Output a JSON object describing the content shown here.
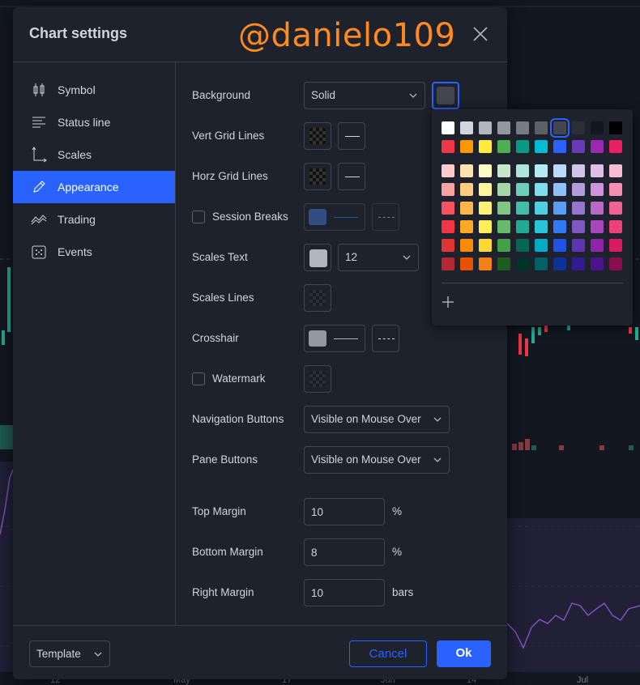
{
  "dialog": {
    "title": "Chart settings",
    "watermark_overlay": "@danielo109",
    "close_icon": "close-icon"
  },
  "sidebar": {
    "items": [
      {
        "label": "Symbol",
        "icon": "candlestick-icon",
        "active": false
      },
      {
        "label": "Status line",
        "icon": "status-line-icon",
        "active": false
      },
      {
        "label": "Scales",
        "icon": "scales-icon",
        "active": false
      },
      {
        "label": "Appearance",
        "icon": "pencil-icon",
        "active": true
      },
      {
        "label": "Trading",
        "icon": "trading-icon",
        "active": false
      },
      {
        "label": "Events",
        "icon": "calendar-icon",
        "active": false
      }
    ]
  },
  "appearance": {
    "background": {
      "label": "Background",
      "value": "Solid",
      "color": "#434651"
    },
    "vert_grid": {
      "label": "Vert Grid Lines"
    },
    "horz_grid": {
      "label": "Horz Grid Lines"
    },
    "session_breaks": {
      "label": "Session Breaks",
      "checked": false,
      "color": "#3a5a9e"
    },
    "scales_text": {
      "label": "Scales Text",
      "color": "#b2b5be",
      "size": "12"
    },
    "scales_lines": {
      "label": "Scales Lines"
    },
    "crosshair": {
      "label": "Crosshair",
      "color": "#9598a1"
    },
    "watermark": {
      "label": "Watermark",
      "checked": false
    },
    "navigation_buttons": {
      "label": "Navigation Buttons",
      "value": "Visible on Mouse Over"
    },
    "pane_buttons": {
      "label": "Pane Buttons",
      "value": "Visible on Mouse Over"
    },
    "top_margin": {
      "label": "Top Margin",
      "value": "10",
      "unit": "%"
    },
    "bottom_margin": {
      "label": "Bottom Margin",
      "value": "8",
      "unit": "%"
    },
    "right_margin": {
      "label": "Right Margin",
      "value": "10",
      "unit": "bars"
    }
  },
  "footer": {
    "template_label": "Template",
    "cancel_label": "Cancel",
    "ok_label": "Ok"
  },
  "palette": {
    "selected": "#434651",
    "add_icon": "plus-icon",
    "rows": [
      [
        "#ffffff",
        "#d1d4dc",
        "#b2b5be",
        "#9598a1",
        "#787b86",
        "#5d606b",
        "#434651",
        "#2a2e39",
        "#131722",
        "#000000"
      ],
      [
        "#f23645",
        "#ff9800",
        "#ffeb3b",
        "#4caf50",
        "#089981",
        "#00bcd4",
        "#2962ff",
        "#673ab7",
        "#9c27b0",
        "#e91e63"
      ],
      [
        "#fccbcd",
        "#ffe0b2",
        "#fff9c4",
        "#c8e6c9",
        "#ace5dc",
        "#b2ebf2",
        "#bbd9fb",
        "#d1c4e9",
        "#e1bee7",
        "#f8bbd0"
      ],
      [
        "#faa1a4",
        "#ffcc80",
        "#fff59d",
        "#a5d6a7",
        "#70ccbd",
        "#80deea",
        "#90bff9",
        "#b39ddb",
        "#ce93d8",
        "#f48fb1"
      ],
      [
        "#f7525f",
        "#ffb74d",
        "#fff176",
        "#81c784",
        "#42bda8",
        "#4dd0e1",
        "#5b9cf6",
        "#9575cd",
        "#ba68c8",
        "#f06292"
      ],
      [
        "#f23645",
        "#ffa726",
        "#ffee58",
        "#66bb6a",
        "#22ab94",
        "#26c6da",
        "#3179f5",
        "#7e57c2",
        "#ab47bc",
        "#ec407a"
      ],
      [
        "#e13535",
        "#fb8c00",
        "#fdd835",
        "#43a047",
        "#056656",
        "#00acc1",
        "#1e53e5",
        "#5e35b1",
        "#8e24aa",
        "#d81b60"
      ],
      [
        "#b22833",
        "#e65100",
        "#f57f17",
        "#1b5e20",
        "#00332a",
        "#006064",
        "#0c3299",
        "#311b92",
        "#4a148c",
        "#880e4f"
      ]
    ]
  },
  "chart_axis": {
    "labels": [
      "12",
      "May",
      "17",
      "Jun",
      "14",
      "Jul"
    ]
  }
}
